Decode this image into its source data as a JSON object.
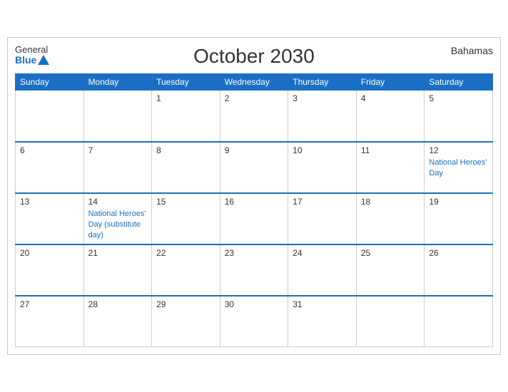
{
  "header": {
    "title": "October 2030",
    "country": "Bahamas",
    "logo_general": "General",
    "logo_blue": "Blue"
  },
  "weekdays": [
    "Sunday",
    "Monday",
    "Tuesday",
    "Wednesday",
    "Thursday",
    "Friday",
    "Saturday"
  ],
  "weeks": [
    [
      {
        "day": "",
        "event": ""
      },
      {
        "day": "",
        "event": ""
      },
      {
        "day": "1",
        "event": ""
      },
      {
        "day": "2",
        "event": ""
      },
      {
        "day": "3",
        "event": ""
      },
      {
        "day": "4",
        "event": ""
      },
      {
        "day": "5",
        "event": ""
      }
    ],
    [
      {
        "day": "6",
        "event": ""
      },
      {
        "day": "7",
        "event": ""
      },
      {
        "day": "8",
        "event": ""
      },
      {
        "day": "9",
        "event": ""
      },
      {
        "day": "10",
        "event": ""
      },
      {
        "day": "11",
        "event": ""
      },
      {
        "day": "12",
        "event": "National Heroes' Day"
      }
    ],
    [
      {
        "day": "13",
        "event": ""
      },
      {
        "day": "14",
        "event": "National Heroes' Day (substitute day)"
      },
      {
        "day": "15",
        "event": ""
      },
      {
        "day": "16",
        "event": ""
      },
      {
        "day": "17",
        "event": ""
      },
      {
        "day": "18",
        "event": ""
      },
      {
        "day": "19",
        "event": ""
      }
    ],
    [
      {
        "day": "20",
        "event": ""
      },
      {
        "day": "21",
        "event": ""
      },
      {
        "day": "22",
        "event": ""
      },
      {
        "day": "23",
        "event": ""
      },
      {
        "day": "24",
        "event": ""
      },
      {
        "day": "25",
        "event": ""
      },
      {
        "day": "26",
        "event": ""
      }
    ],
    [
      {
        "day": "27",
        "event": ""
      },
      {
        "day": "28",
        "event": ""
      },
      {
        "day": "29",
        "event": ""
      },
      {
        "day": "30",
        "event": ""
      },
      {
        "day": "31",
        "event": ""
      },
      {
        "day": "",
        "event": ""
      },
      {
        "day": "",
        "event": ""
      }
    ]
  ]
}
